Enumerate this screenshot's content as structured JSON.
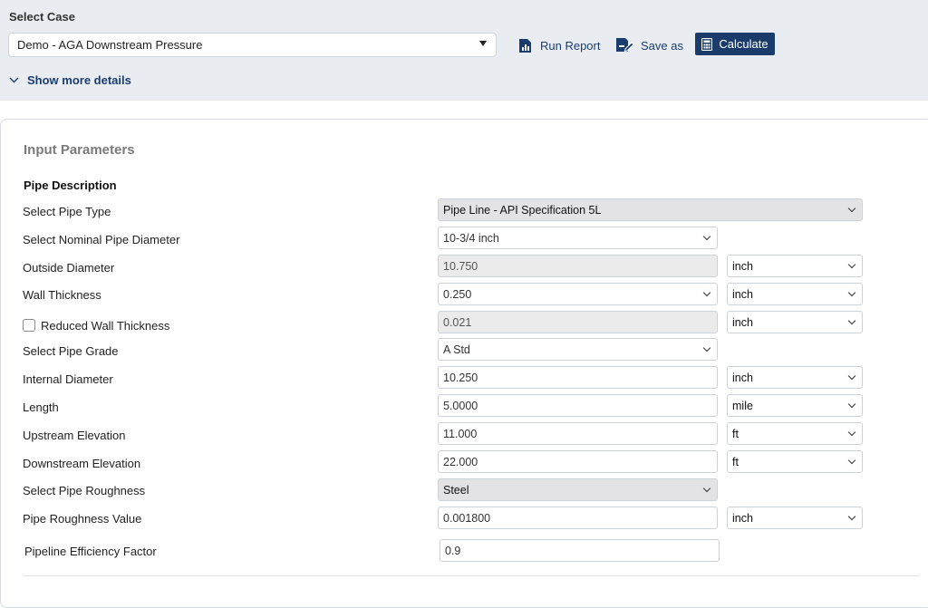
{
  "header": {
    "select_case_label": "Select Case",
    "case_value": "Demo - AGA Downstream Pressure",
    "run_report_label": "Run Report",
    "save_as_label": "Save as",
    "calculate_label": "Calculate",
    "show_more_label": "Show more details"
  },
  "panel": {
    "title": "Input Parameters",
    "section_title": "Pipe Description"
  },
  "rows": [
    {
      "label": "Select Pipe Type",
      "value": "Pipe Line - API Specification 5L",
      "unit": ""
    },
    {
      "label": "Select Nominal Pipe Diameter",
      "value": "10-3/4 inch",
      "unit": ""
    },
    {
      "label": "Outside Diameter",
      "value": "10.750",
      "unit": "inch"
    },
    {
      "label": "Wall Thickness",
      "value": "0.250",
      "unit": "inch"
    },
    {
      "label": "Reduced Wall Thickness",
      "value": "0.021",
      "unit": "inch"
    },
    {
      "label": "Select Pipe Grade",
      "value": "A Std",
      "unit": ""
    },
    {
      "label": "Internal Diameter",
      "value": "10.250",
      "unit": "inch"
    },
    {
      "label": "Length",
      "value": "5.0000",
      "unit": "mile"
    },
    {
      "label": "Upstream Elevation",
      "value": "11.000",
      "unit": "ft"
    },
    {
      "label": "Downstream Elevation",
      "value": "22.000",
      "unit": "ft"
    },
    {
      "label": "Select Pipe Roughness",
      "value": "Steel",
      "unit": ""
    },
    {
      "label": "Pipe Roughness Value",
      "value": "0.001800",
      "unit": "inch"
    },
    {
      "label": "Pipeline Efficiency Factor",
      "value": "0.9",
      "unit": ""
    }
  ],
  "colors": {
    "header_bg": "#e9edf2",
    "accent": "#1b3c6b",
    "link": "#1a3d6e"
  }
}
